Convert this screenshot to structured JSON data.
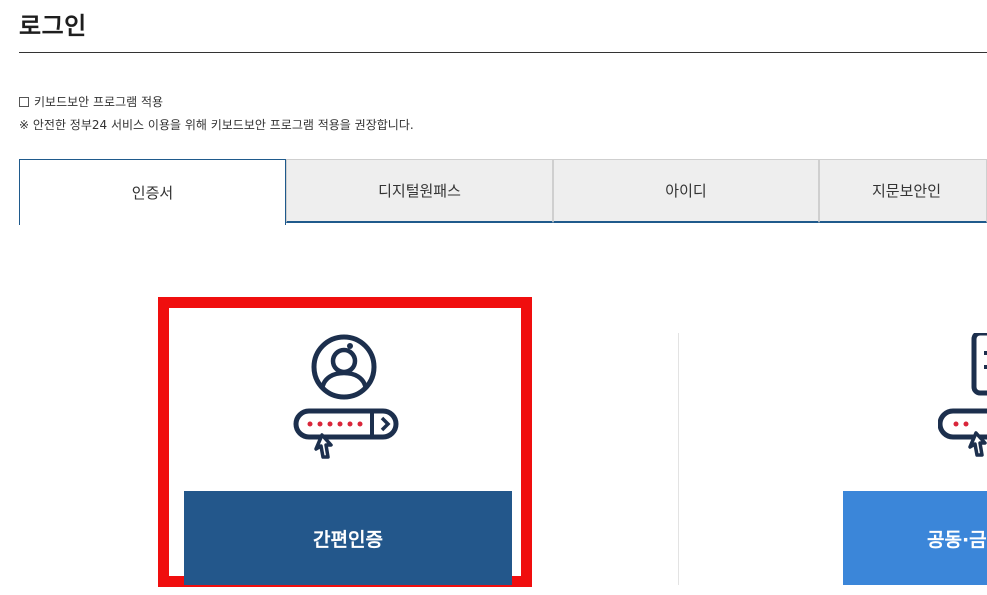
{
  "page": {
    "title": "로그인"
  },
  "keyboard_security": {
    "checkbox_label": "키보드보안 프로그램 적용",
    "notice": "※ 안전한 정부24 서비스 이용을 위해 키보드보안 프로그램 적용을 권장합니다."
  },
  "tabs": [
    {
      "label": "인증서",
      "active": true
    },
    {
      "label": "디지털원패스",
      "active": false
    },
    {
      "label": "아이디",
      "active": false
    },
    {
      "label": "지문보안인",
      "active": false
    }
  ],
  "login_options": {
    "simple": {
      "button_label": "간편인증",
      "icon": "user-password-icon",
      "highlighted": true
    },
    "joint": {
      "button_label": "공동·금",
      "icon": "certificate-password-icon"
    }
  },
  "colors": {
    "primary_dark": "#23578b",
    "primary_light": "#3b86d9",
    "highlight": "#f00e0e",
    "tab_border": "#1f5a8c"
  }
}
